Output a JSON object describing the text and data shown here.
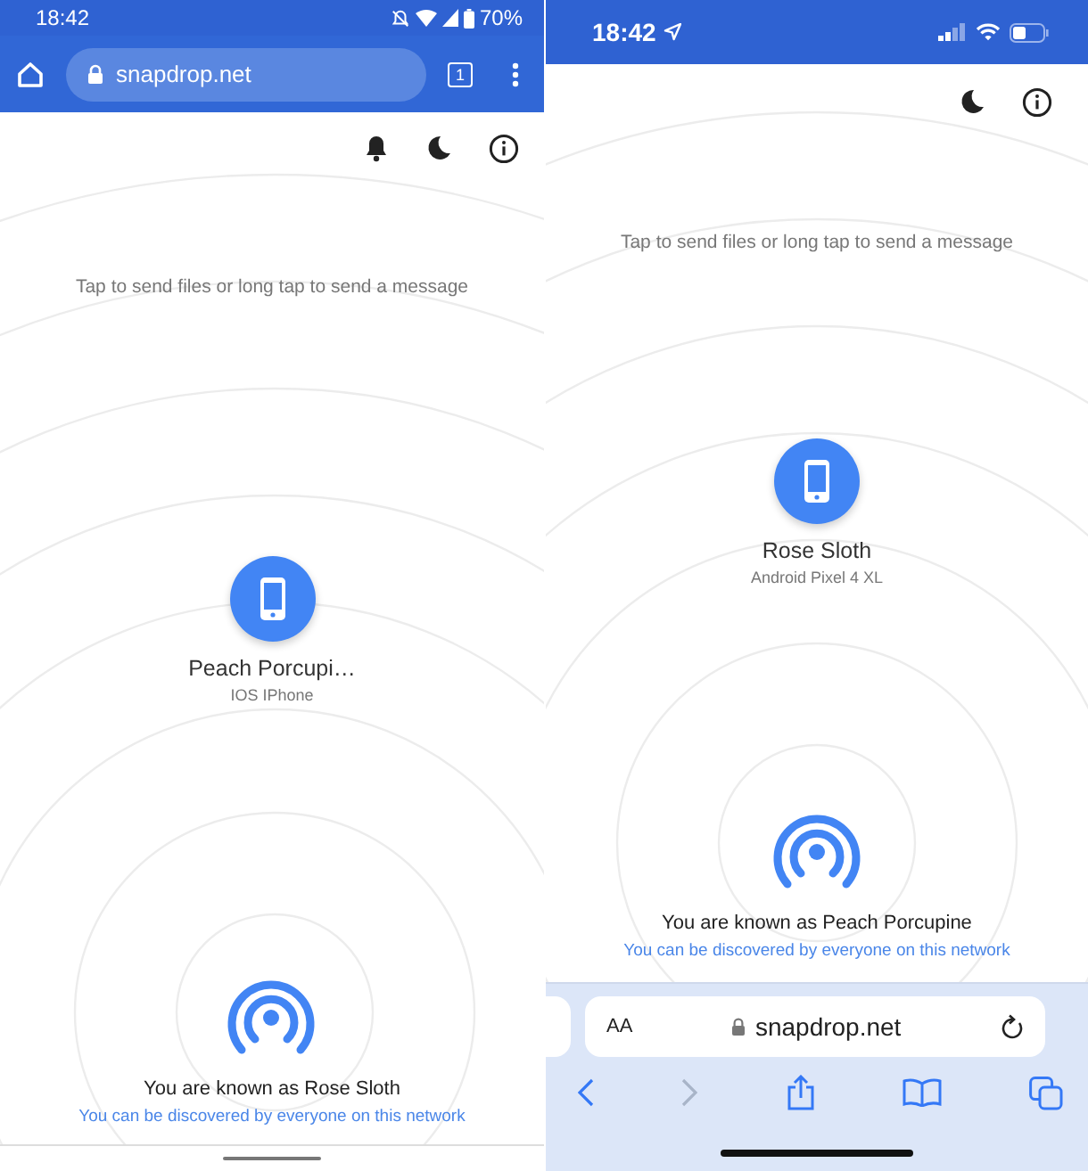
{
  "android_screen": {
    "status_bar": {
      "time": "18:42",
      "battery": "70%"
    },
    "address_bar": {
      "url": "snapdrop.net",
      "tab_count": "1"
    },
    "hint": "Tap to send files or long tap to send a message",
    "peers": [
      {
        "name": "Peach Porcupi…",
        "device": "IOS IPhone"
      }
    ],
    "self": {
      "title": "You are known as Rose Sloth",
      "subtitle": "You can be discovered by everyone on this network"
    }
  },
  "ios_screen": {
    "status_bar": {
      "time": "18:42"
    },
    "hint": "Tap to send files or long tap to send a message",
    "peers": [
      {
        "name": "Rose Sloth",
        "device": "Android Pixel 4 XL"
      }
    ],
    "self": {
      "title": "You are known as Peach Porcupine",
      "subtitle": "You can be discovered by everyone on this network"
    },
    "address_bar": {
      "text_size": "AA",
      "url": "snapdrop.net"
    }
  }
}
